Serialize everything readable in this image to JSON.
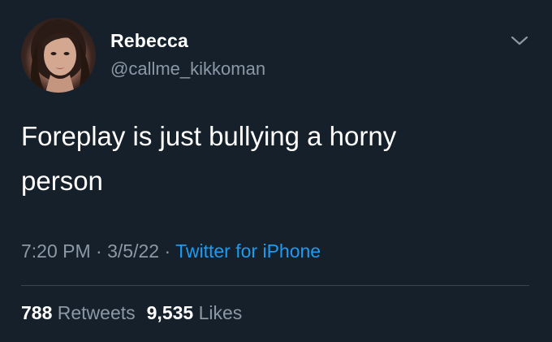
{
  "tweet": {
    "display_name": "Rebecca",
    "handle": "@callme_kikkoman",
    "text": "Foreplay is just bullying a horny\nperson",
    "time": "7:20 PM",
    "date": "3/5/22",
    "separator": "·",
    "source": "Twitter for iPhone",
    "retweets_count": "788",
    "retweets_label": "Retweets",
    "likes_count": "9,535",
    "likes_label": "Likes",
    "menu_icon": "chevron-down-icon",
    "avatar_icon": "profile-photo"
  },
  "colors": {
    "background": "#15202b",
    "primary_text": "#ffffff",
    "secondary_text": "#8b98a5",
    "link": "#1d9bf0",
    "divider": "#38444d"
  }
}
